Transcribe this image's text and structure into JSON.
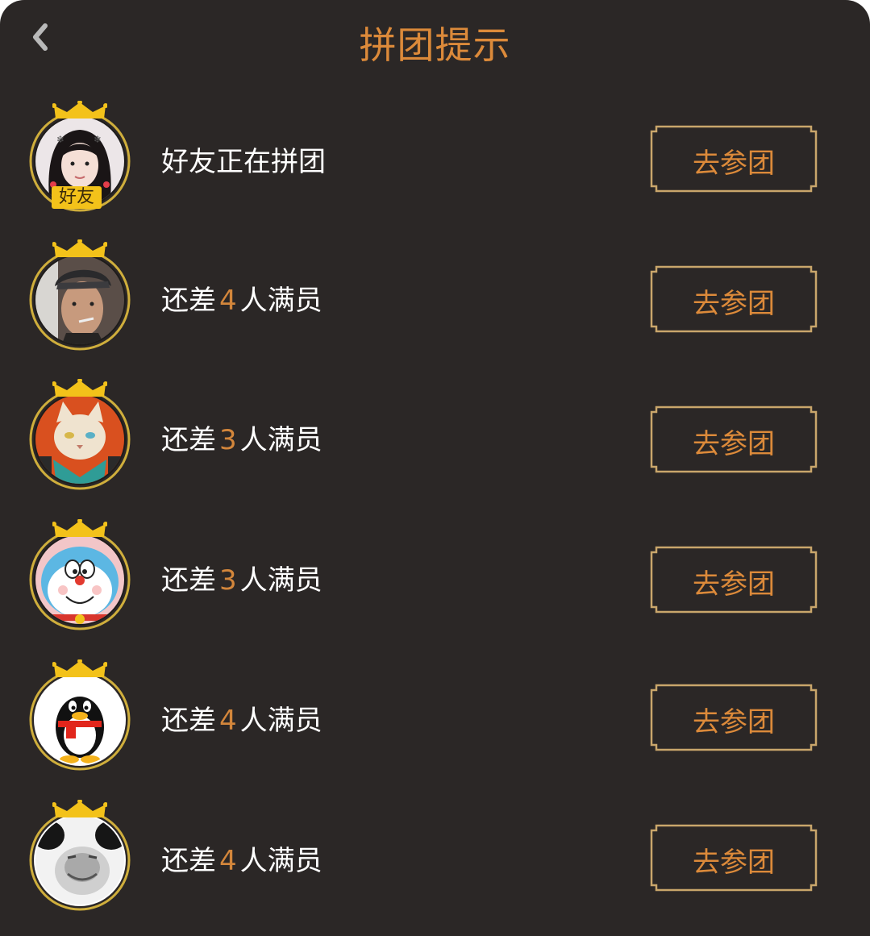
{
  "header": {
    "title": "拼团提示",
    "back_icon": "chevron-left-icon"
  },
  "colors": {
    "background": "#2b2726",
    "accent": "#dc8a3a",
    "gold_border": "#c9a66b",
    "crown": "#f3c21a"
  },
  "rows": [
    {
      "prefix": "好友正在拼团",
      "number": "",
      "suffix": "",
      "button": "去参团",
      "avatar": "friend-girl-photo-avatar",
      "tag": "好友"
    },
    {
      "prefix": "还差",
      "number": "4",
      "suffix": "人满员",
      "button": "去参团",
      "avatar": "young-man-photo-avatar"
    },
    {
      "prefix": "还差",
      "number": "3",
      "suffix": "人满员",
      "button": "去参团",
      "avatar": "cartoon-cat-avatar"
    },
    {
      "prefix": "还差",
      "number": "3",
      "suffix": "人满员",
      "button": "去参团",
      "avatar": "doraemon-avatar"
    },
    {
      "prefix": "还差",
      "number": "4",
      "suffix": "人满员",
      "button": "去参团",
      "avatar": "qq-penguin-avatar"
    },
    {
      "prefix": "还差",
      "number": "4",
      "suffix": "人满员",
      "button": "去参团",
      "avatar": "panda-meme-avatar"
    }
  ]
}
